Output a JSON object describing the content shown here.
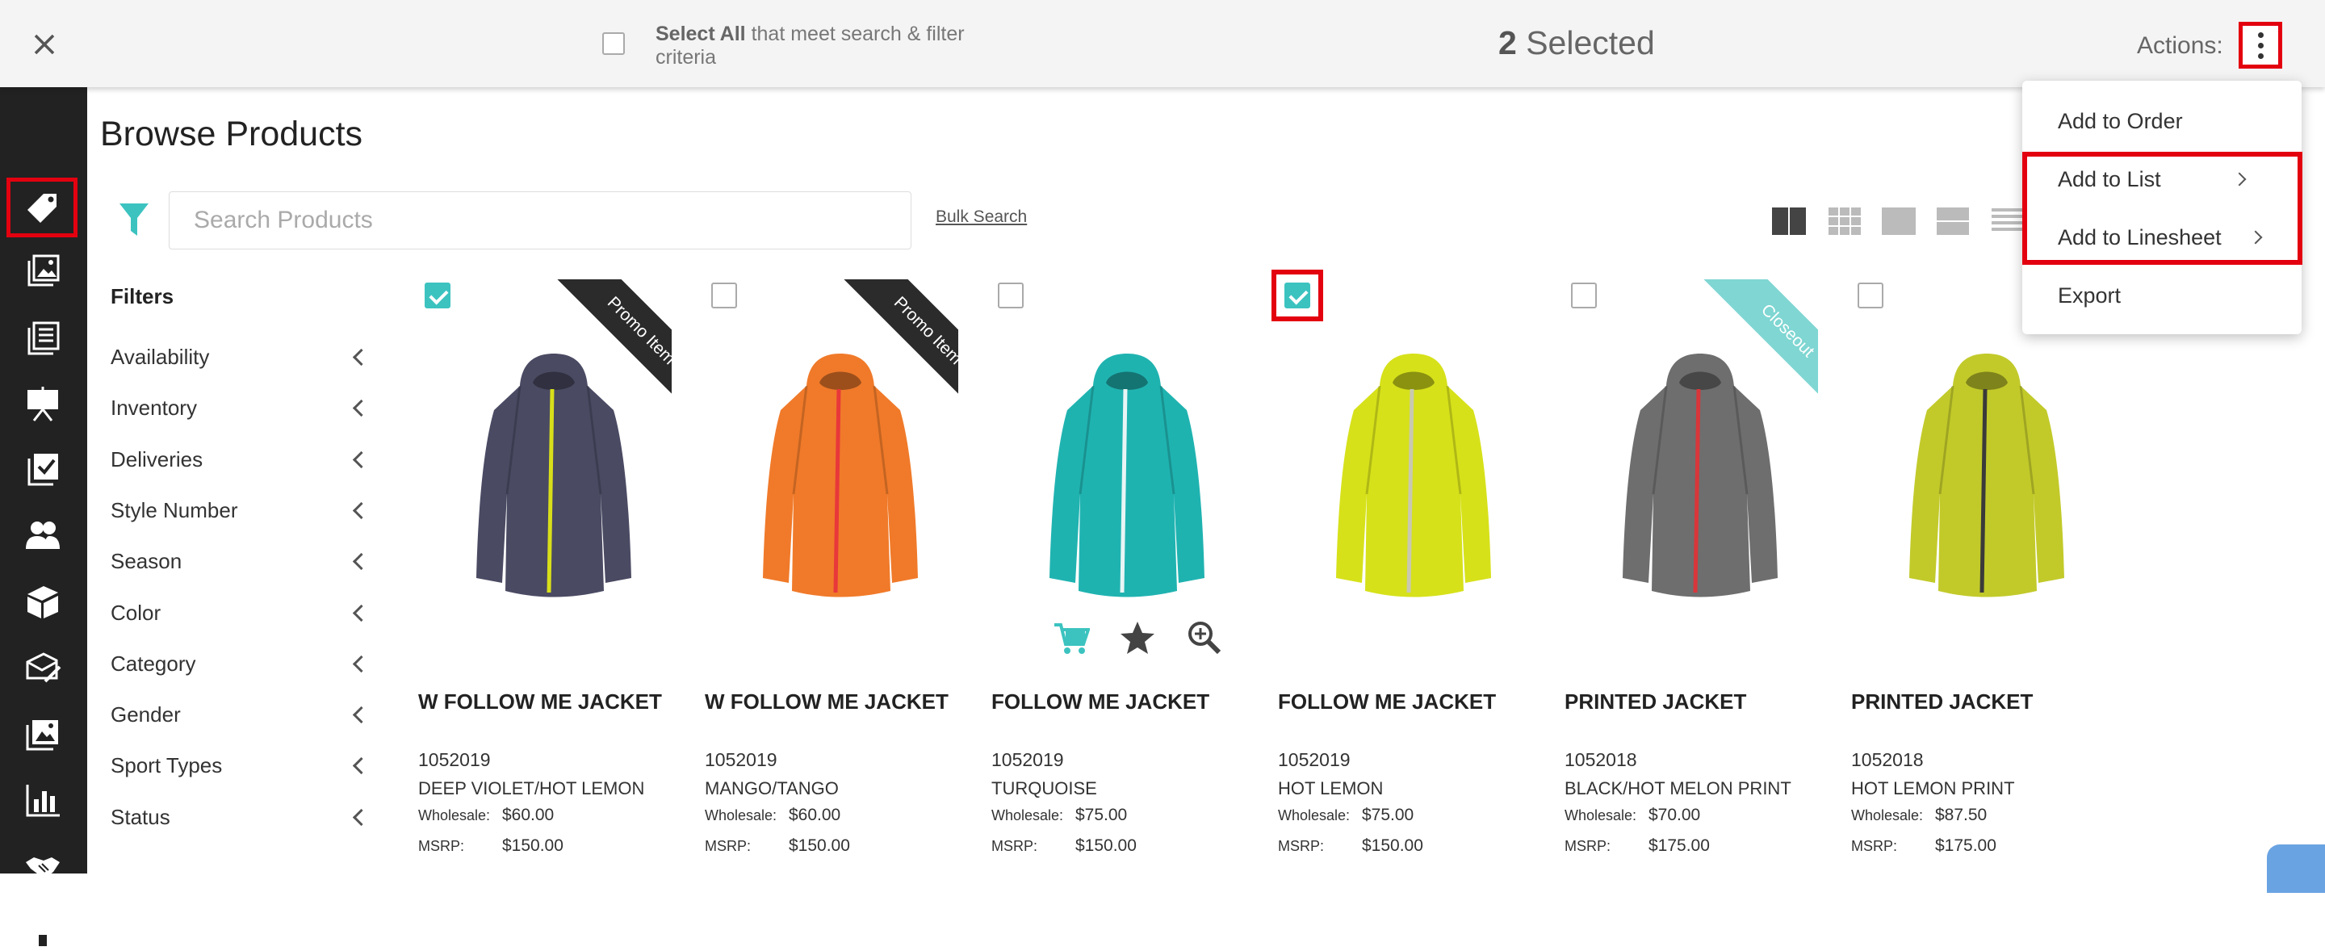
{
  "topbar": {
    "select_all_bold": "Select All",
    "select_all_rest": " that meet search & filter criteria",
    "selected_number": "2",
    "selected_label": " Selected",
    "actions_label": "Actions:"
  },
  "dropdown": {
    "items": [
      "Add to Order",
      "Add to List",
      "Add to Linesheet",
      "Export"
    ]
  },
  "sidebar": {
    "items": [
      "tag",
      "lookbook",
      "catalog",
      "presentation",
      "checklist",
      "customers",
      "packages",
      "sales-messages",
      "images",
      "reports",
      "handshake",
      "storefront"
    ]
  },
  "page": {
    "title": "Browse Products",
    "search_placeholder": "Search Products",
    "bulk_search": "Bulk Search"
  },
  "filters": {
    "heading": "Filters",
    "items": [
      "Availability",
      "Inventory",
      "Deliveries",
      "Style Number",
      "Season",
      "Color",
      "Category",
      "Gender",
      "Sport Types",
      "Status"
    ]
  },
  "labels": {
    "wholesale": "Wholesale:",
    "msrp": "MSRP:"
  },
  "colors": {
    "accent": "#3cc3c0",
    "highlight": "#e3000f",
    "sidebar": "#222222",
    "promo_ribbon": "#2b2b2b",
    "closeout_ribbon": "#7fd6d2"
  },
  "products": [
    {
      "name": "W FOLLOW ME JACKET",
      "number": "1052019",
      "color": "DEEP VIOLET/HOT LEMON",
      "wholesale": "$60.00",
      "msrp": "$150.00",
      "checked": true,
      "ribbon": "Promo Item",
      "jacket_color": "#4a4a63",
      "zip_color": "#d8df1a"
    },
    {
      "name": "W FOLLOW ME JACKET",
      "number": "1052019",
      "color": "MANGO/TANGO",
      "wholesale": "$60.00",
      "msrp": "$150.00",
      "checked": false,
      "ribbon": "Promo Item",
      "jacket_color": "#f07a2a",
      "zip_color": "#e8383a"
    },
    {
      "name": "FOLLOW ME JACKET",
      "number": "1052019",
      "color": "TURQUOISE",
      "wholesale": "$75.00",
      "msrp": "$150.00",
      "checked": false,
      "ribbon": "",
      "jacket_color": "#1fb3b0",
      "zip_color": "#e9f5f5"
    },
    {
      "name": "FOLLOW ME JACKET",
      "number": "1052019",
      "color": "HOT LEMON",
      "wholesale": "$75.00",
      "msrp": "$150.00",
      "checked": true,
      "ribbon": "",
      "jacket_color": "#d6e11a",
      "zip_color": "#c9c9b0"
    },
    {
      "name": "PRINTED JACKET",
      "number": "1052018",
      "color": "BLACK/HOT MELON PRINT",
      "wholesale": "$70.00",
      "msrp": "$175.00",
      "checked": false,
      "ribbon": "Closeout",
      "jacket_color": "#6e6e6e",
      "zip_color": "#d8363a"
    },
    {
      "name": "PRINTED JACKET",
      "number": "1052018",
      "color": "HOT LEMON PRINT",
      "wholesale": "$87.50",
      "msrp": "$175.00",
      "checked": false,
      "ribbon": "",
      "jacket_color": "#c2ca2a",
      "zip_color": "#3a3a3a"
    }
  ]
}
